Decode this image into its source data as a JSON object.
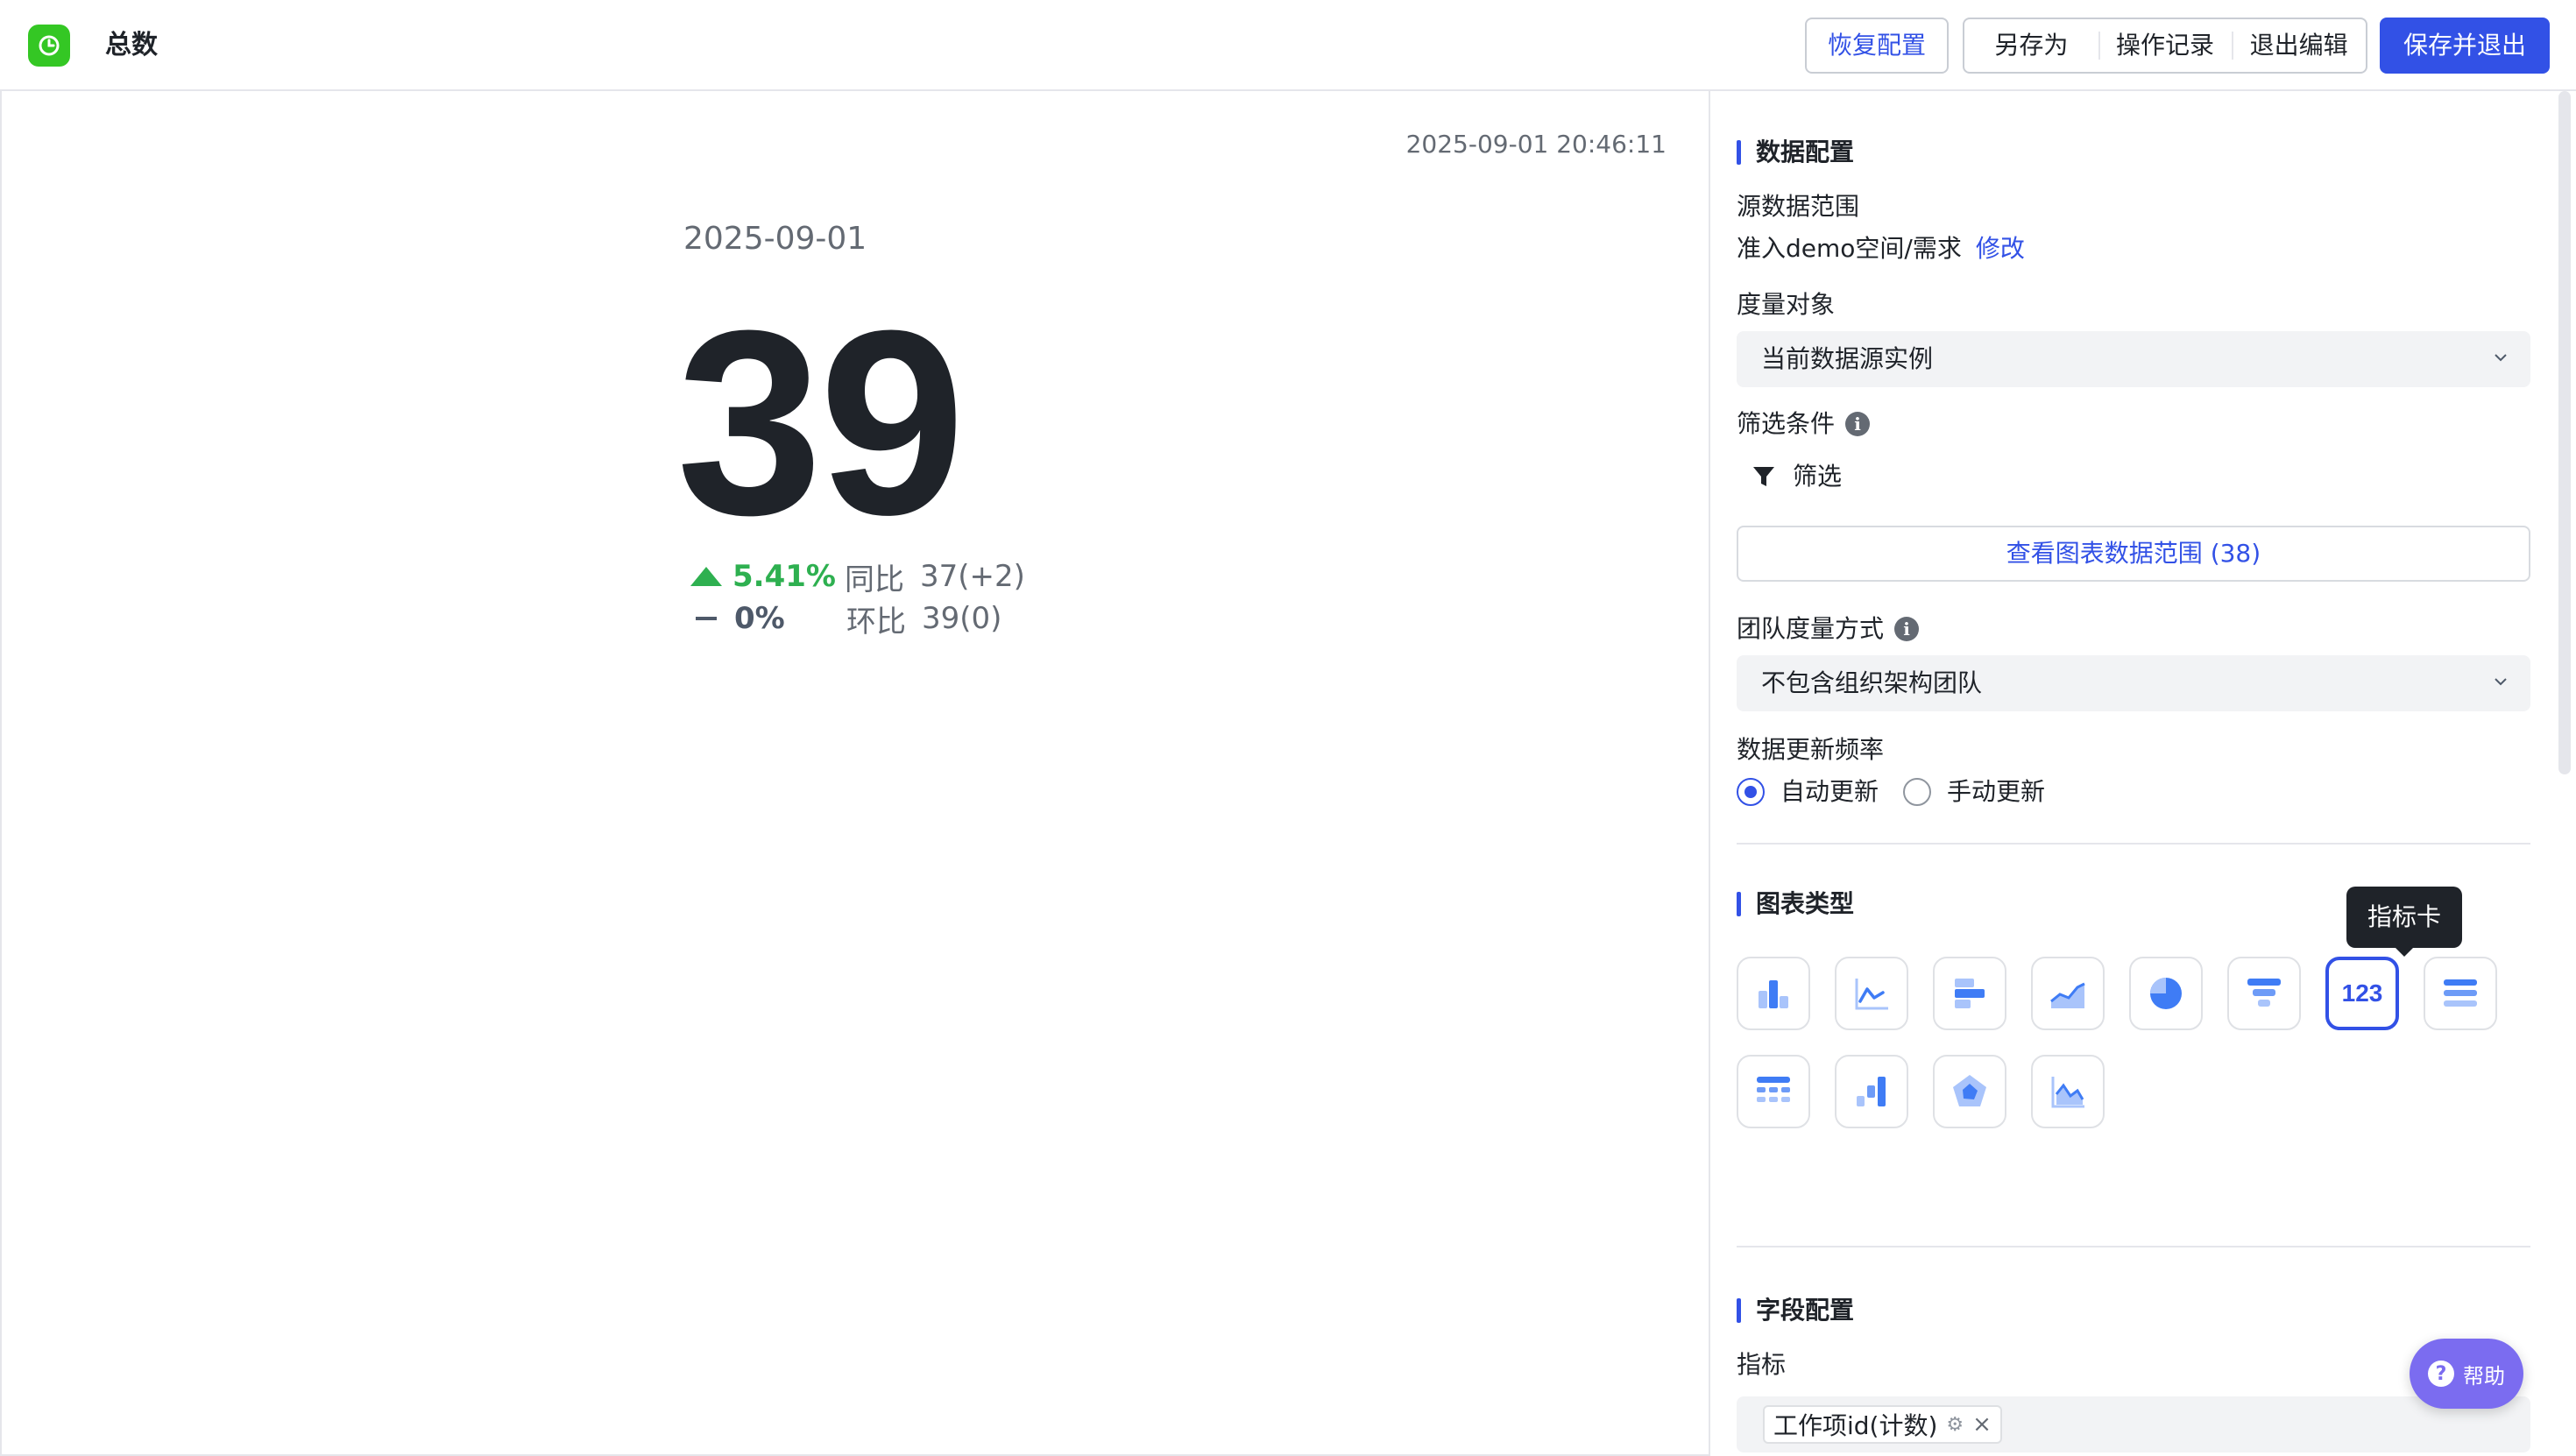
{
  "header": {
    "title": "总数",
    "restore_label": "恢复配置",
    "save_as_label": "另存为",
    "history_label": "操作记录",
    "exit_edit_label": "退出编辑",
    "save_exit_label": "保存并退出"
  },
  "preview": {
    "timestamp": "2025-09-01 20:46:11",
    "date": "2025-09-01",
    "value": "39",
    "yoy": {
      "pct": "5.41%",
      "label": "同比",
      "value": "37(+2)"
    },
    "mom": {
      "pct": "0%",
      "label": "环比",
      "value": "39(0)"
    }
  },
  "panel": {
    "data_config": {
      "title": "数据配置",
      "source_label": "源数据范围",
      "source_value": "准入demo空间/需求",
      "source_edit": "修改",
      "measure_label": "度量对象",
      "measure_value": "当前数据源实例",
      "filter_label": "筛选条件",
      "filter_button": "筛选",
      "range_button": "查看图表数据范围 (38)",
      "team_label": "团队度量方式",
      "team_value": "不包含组织架构团队",
      "freq_label": "数据更新频率",
      "freq_auto": "自动更新",
      "freq_manual": "手动更新"
    },
    "chart_type": {
      "title": "图表类型",
      "tooltip": "指标卡",
      "selected_text": "123"
    },
    "field_config": {
      "title": "字段配置",
      "metric_label": "指标",
      "metric_tag": "工作项id(计数)"
    }
  },
  "help_label": "帮助",
  "colors": {
    "primary": "#3251e6",
    "up": "#2eb050",
    "logo": "#34c724"
  }
}
